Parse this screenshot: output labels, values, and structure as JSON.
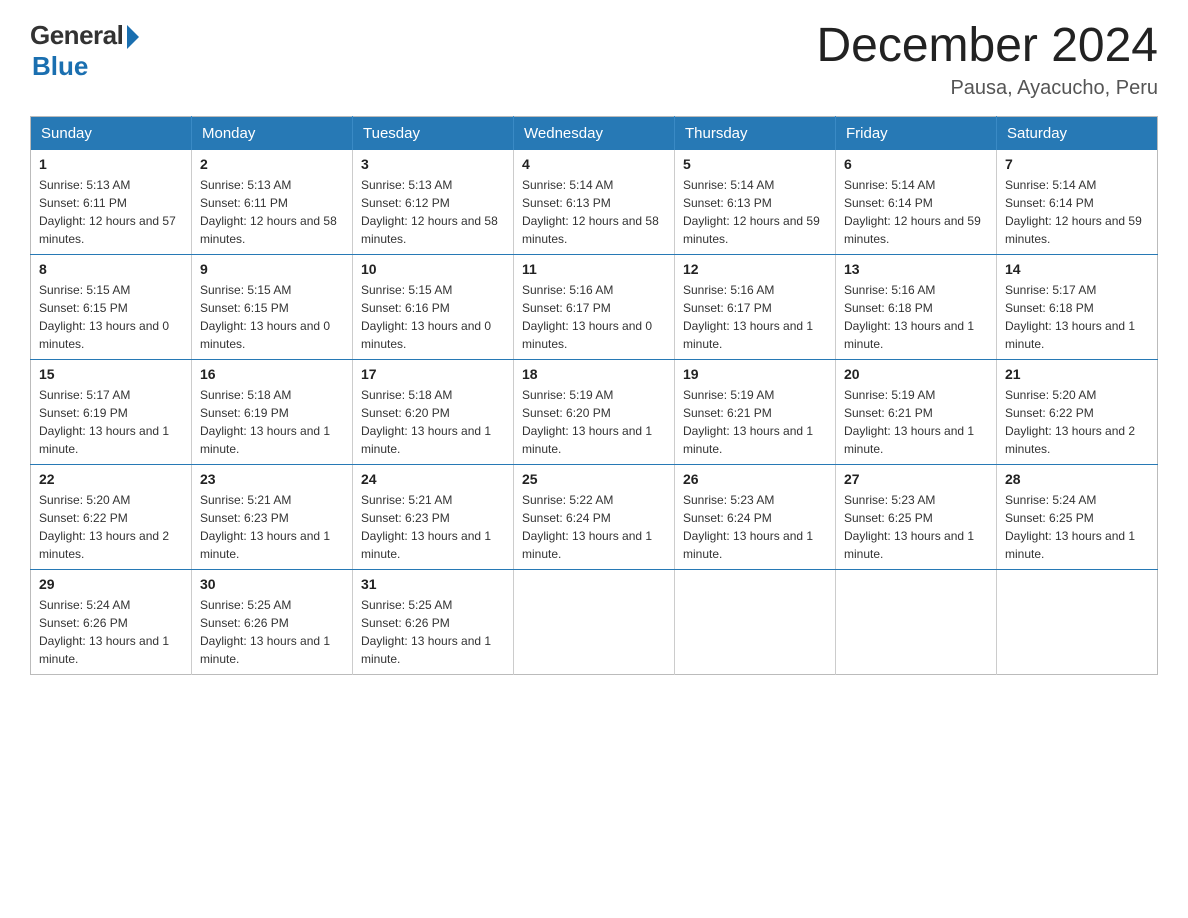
{
  "logo": {
    "general": "General",
    "blue": "Blue",
    "subtitle": "Blue"
  },
  "header": {
    "month_title": "December 2024",
    "location": "Pausa, Ayacucho, Peru"
  },
  "weekdays": [
    "Sunday",
    "Monday",
    "Tuesday",
    "Wednesday",
    "Thursday",
    "Friday",
    "Saturday"
  ],
  "weeks": [
    [
      {
        "day": "1",
        "sunrise": "5:13 AM",
        "sunset": "6:11 PM",
        "daylight": "12 hours and 57 minutes."
      },
      {
        "day": "2",
        "sunrise": "5:13 AM",
        "sunset": "6:11 PM",
        "daylight": "12 hours and 58 minutes."
      },
      {
        "day": "3",
        "sunrise": "5:13 AM",
        "sunset": "6:12 PM",
        "daylight": "12 hours and 58 minutes."
      },
      {
        "day": "4",
        "sunrise": "5:14 AM",
        "sunset": "6:13 PM",
        "daylight": "12 hours and 58 minutes."
      },
      {
        "day": "5",
        "sunrise": "5:14 AM",
        "sunset": "6:13 PM",
        "daylight": "12 hours and 59 minutes."
      },
      {
        "day": "6",
        "sunrise": "5:14 AM",
        "sunset": "6:14 PM",
        "daylight": "12 hours and 59 minutes."
      },
      {
        "day": "7",
        "sunrise": "5:14 AM",
        "sunset": "6:14 PM",
        "daylight": "12 hours and 59 minutes."
      }
    ],
    [
      {
        "day": "8",
        "sunrise": "5:15 AM",
        "sunset": "6:15 PM",
        "daylight": "13 hours and 0 minutes."
      },
      {
        "day": "9",
        "sunrise": "5:15 AM",
        "sunset": "6:15 PM",
        "daylight": "13 hours and 0 minutes."
      },
      {
        "day": "10",
        "sunrise": "5:15 AM",
        "sunset": "6:16 PM",
        "daylight": "13 hours and 0 minutes."
      },
      {
        "day": "11",
        "sunrise": "5:16 AM",
        "sunset": "6:17 PM",
        "daylight": "13 hours and 0 minutes."
      },
      {
        "day": "12",
        "sunrise": "5:16 AM",
        "sunset": "6:17 PM",
        "daylight": "13 hours and 1 minute."
      },
      {
        "day": "13",
        "sunrise": "5:16 AM",
        "sunset": "6:18 PM",
        "daylight": "13 hours and 1 minute."
      },
      {
        "day": "14",
        "sunrise": "5:17 AM",
        "sunset": "6:18 PM",
        "daylight": "13 hours and 1 minute."
      }
    ],
    [
      {
        "day": "15",
        "sunrise": "5:17 AM",
        "sunset": "6:19 PM",
        "daylight": "13 hours and 1 minute."
      },
      {
        "day": "16",
        "sunrise": "5:18 AM",
        "sunset": "6:19 PM",
        "daylight": "13 hours and 1 minute."
      },
      {
        "day": "17",
        "sunrise": "5:18 AM",
        "sunset": "6:20 PM",
        "daylight": "13 hours and 1 minute."
      },
      {
        "day": "18",
        "sunrise": "5:19 AM",
        "sunset": "6:20 PM",
        "daylight": "13 hours and 1 minute."
      },
      {
        "day": "19",
        "sunrise": "5:19 AM",
        "sunset": "6:21 PM",
        "daylight": "13 hours and 1 minute."
      },
      {
        "day": "20",
        "sunrise": "5:19 AM",
        "sunset": "6:21 PM",
        "daylight": "13 hours and 1 minute."
      },
      {
        "day": "21",
        "sunrise": "5:20 AM",
        "sunset": "6:22 PM",
        "daylight": "13 hours and 2 minutes."
      }
    ],
    [
      {
        "day": "22",
        "sunrise": "5:20 AM",
        "sunset": "6:22 PM",
        "daylight": "13 hours and 2 minutes."
      },
      {
        "day": "23",
        "sunrise": "5:21 AM",
        "sunset": "6:23 PM",
        "daylight": "13 hours and 1 minute."
      },
      {
        "day": "24",
        "sunrise": "5:21 AM",
        "sunset": "6:23 PM",
        "daylight": "13 hours and 1 minute."
      },
      {
        "day": "25",
        "sunrise": "5:22 AM",
        "sunset": "6:24 PM",
        "daylight": "13 hours and 1 minute."
      },
      {
        "day": "26",
        "sunrise": "5:23 AM",
        "sunset": "6:24 PM",
        "daylight": "13 hours and 1 minute."
      },
      {
        "day": "27",
        "sunrise": "5:23 AM",
        "sunset": "6:25 PM",
        "daylight": "13 hours and 1 minute."
      },
      {
        "day": "28",
        "sunrise": "5:24 AM",
        "sunset": "6:25 PM",
        "daylight": "13 hours and 1 minute."
      }
    ],
    [
      {
        "day": "29",
        "sunrise": "5:24 AM",
        "sunset": "6:26 PM",
        "daylight": "13 hours and 1 minute."
      },
      {
        "day": "30",
        "sunrise": "5:25 AM",
        "sunset": "6:26 PM",
        "daylight": "13 hours and 1 minute."
      },
      {
        "day": "31",
        "sunrise": "5:25 AM",
        "sunset": "6:26 PM",
        "daylight": "13 hours and 1 minute."
      },
      null,
      null,
      null,
      null
    ]
  ]
}
